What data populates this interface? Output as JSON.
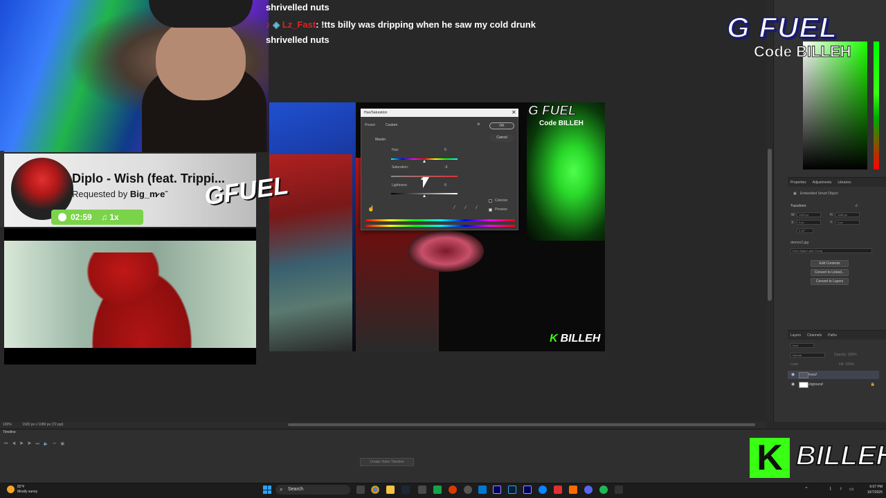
{
  "chat": {
    "line1": "shrivelled nuts",
    "line2_user": "Lz_Fast",
    "line2_text": ": !tts billy was dripping when he saw my cold drunk",
    "line3": "shrivelled nuts"
  },
  "song": {
    "title": "Diplo - Wish (feat. Trippi...",
    "requested_prefix": "Requested by ",
    "requested_by": "Big_m̷ eˉ",
    "time": "02:59",
    "speed": "♫ 1x"
  },
  "brand": {
    "gfuel": "G FUEL",
    "code": "Code BILLEH",
    "billeh_k": "K",
    "billeh": "BILLEH"
  },
  "doc_overlay": {
    "gfuel": "G FUEL",
    "code": "Code BILLEH",
    "gfuel_slant": "GFUEL",
    "billeh_k": "K",
    "billeh": "BILLEH"
  },
  "dialog": {
    "title": "Hue/Saturation",
    "preset_label": "Preset:",
    "preset_value": "Custom",
    "channel": "Master",
    "ok": "OK",
    "cancel": "Cancel",
    "hue_label": "Hue:",
    "hue_value": "0",
    "saturation_label": "Saturation:",
    "saturation_value": "-3",
    "lightness_label": "Lightness:",
    "lightness_value": "0",
    "colorize": "Colorize",
    "preview": "Preview",
    "preview_checked": true,
    "colorize_checked": false
  },
  "ps_panels": {
    "props_tabs": [
      "Properties",
      "Adjustments",
      "Libraries"
    ],
    "props_type": "Embedded Smart Object",
    "transform": "Transform",
    "w_label": "W:",
    "w_value": "1920 px",
    "h_label": "H:",
    "h_value": "1080 px",
    "x_label": "X:",
    "x_value": "0 px",
    "y_label": "Y:",
    "y_value": "0 px",
    "angle_value": "0.00°",
    "file_name": "demon2.jpg",
    "layer_comp": "Don't Apply Layer Comp",
    "edit_contents": "Edit Contents",
    "convert_linked": "Convert to Linked...",
    "convert_layers": "Convert to Layers",
    "layer_tabs": [
      "Layers",
      "Channels",
      "Paths"
    ],
    "kind": "Kind",
    "blend": "Normal",
    "opacity": "Opacity: 100%",
    "lock": "Lock:",
    "fill": "Fill: 100%",
    "layers": [
      {
        "name": "demon2",
        "selected": true
      },
      {
        "name": "Background",
        "selected": false
      }
    ]
  },
  "ps_status": {
    "zoom": "100%",
    "doc_size": "1920 px x 1080 px (72 ppi)"
  },
  "timeline": {
    "tab": "Timeline",
    "create_btn": "Create Video Timeline"
  },
  "taskbar": {
    "temp": "82°F",
    "weather": "Mostly sunny",
    "search": "Search",
    "time": "6:07 PM",
    "date": "10/7/2025"
  }
}
